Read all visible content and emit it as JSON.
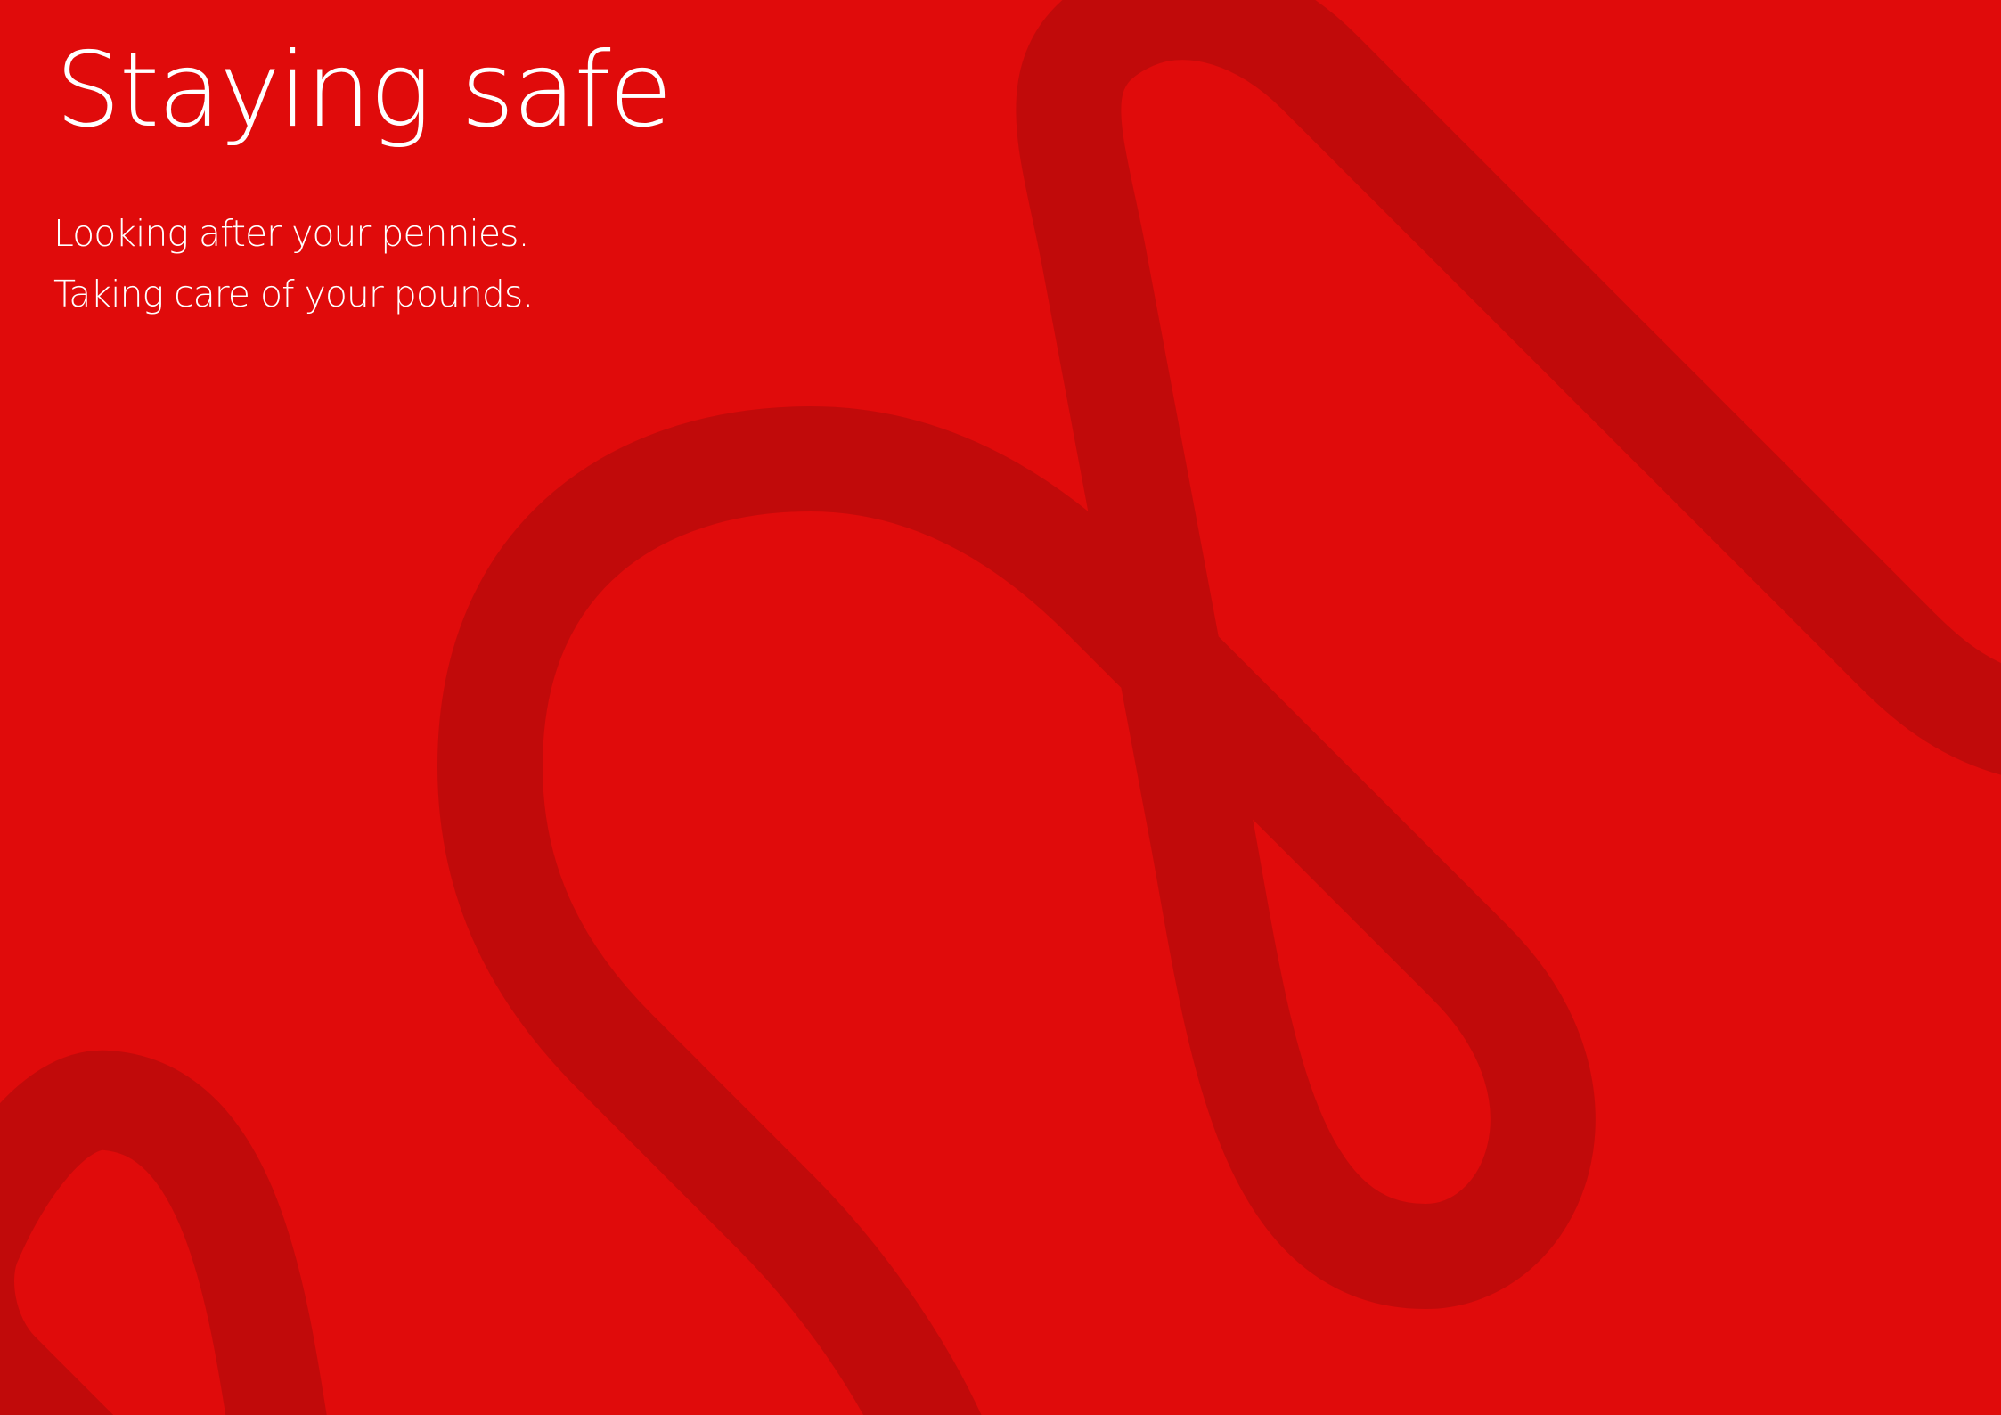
{
  "page": {
    "title": "Staying safe",
    "subtitle_lines": [
      "Looking after your pennies.",
      "Taking care of your pounds."
    ]
  },
  "colors": {
    "background": "#E00B0B",
    "ribbon": "#C10A0A",
    "text": "#FFFFFF"
  }
}
